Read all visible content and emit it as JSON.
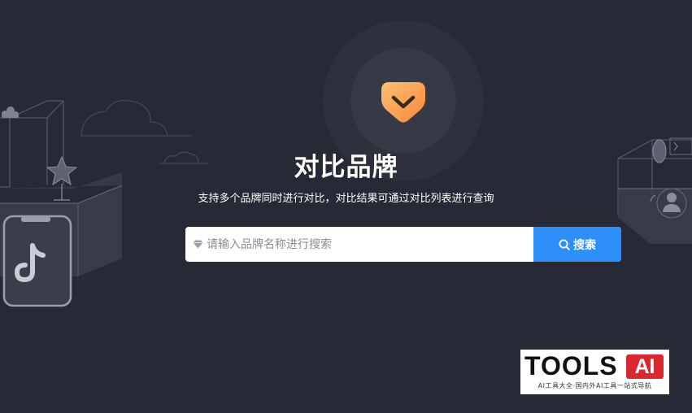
{
  "page": {
    "title": "对比品牌",
    "subtitle": "支持多个品牌同时进行对比，对比结果可通过对比列表进行查询"
  },
  "search": {
    "placeholder": "请输入品牌名称进行搜索",
    "value": "",
    "button_label": "搜索"
  },
  "icons": {
    "logo": "orange-shield-chevron-icon",
    "search_field": "diamond-icon",
    "search_button": "search-icon",
    "left_decor": [
      "cloud-icon",
      "star-icon",
      "tiktok-icon",
      "phone-icon"
    ],
    "right_decor": [
      "play-icon",
      "user-icon"
    ]
  },
  "watermark": {
    "brand": "TOOLS",
    "badge": "AI",
    "tagline": "AI工具大全·国内外AI工具一站式导航"
  },
  "colors": {
    "background": "#272a35",
    "accent": "#2f8ff8",
    "logo_gradient_start": "#ffc073",
    "logo_gradient_end": "#f5883b",
    "watermark_red": "#d9282f"
  }
}
